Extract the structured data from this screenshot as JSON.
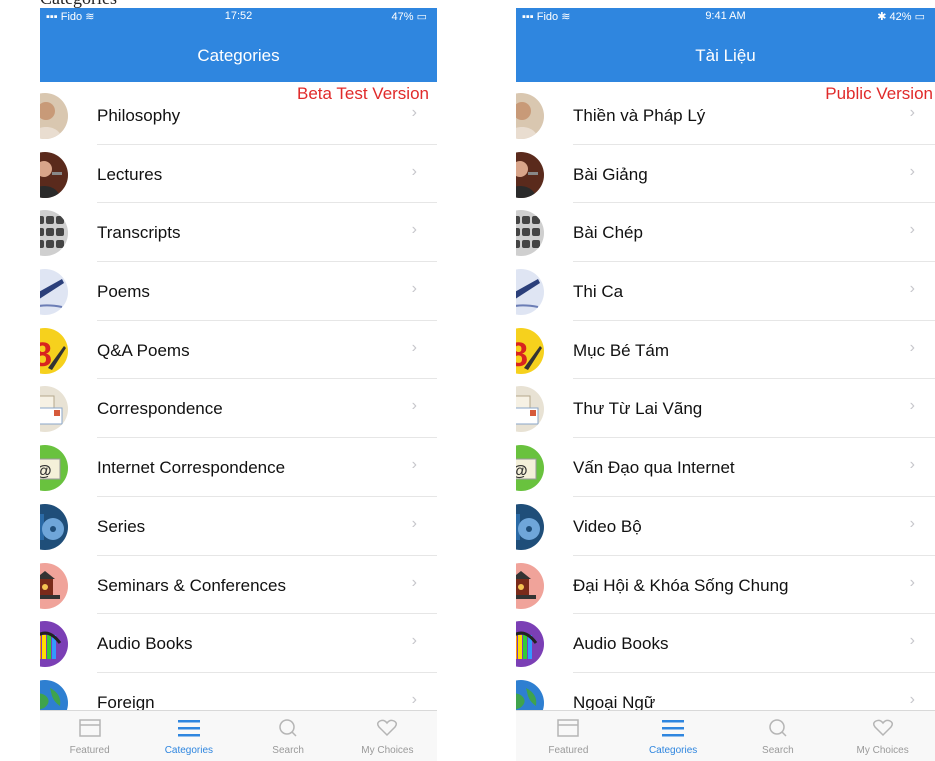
{
  "caption": {
    "text": "Categories"
  },
  "screens": [
    {
      "status": {
        "carrier": "Fido",
        "time": "17:52",
        "battery": "47%"
      },
      "title": "Categories",
      "version_label": "Beta Test Version",
      "items": [
        {
          "label": "Philosophy",
          "icon": "monk-portrait-icon"
        },
        {
          "label": "Lectures",
          "icon": "speaker-portrait-icon"
        },
        {
          "label": "Transcripts",
          "icon": "keyboard-icon"
        },
        {
          "label": "Poems",
          "icon": "fountain-pen-icon"
        },
        {
          "label": "Q&A Poems",
          "icon": "red-8-pen-icon"
        },
        {
          "label": "Correspondence",
          "icon": "letters-icon"
        },
        {
          "label": "Internet Correspondence",
          "icon": "email-at-icon"
        },
        {
          "label": "Series",
          "icon": "dvd-icon"
        },
        {
          "label": "Seminars & Conferences",
          "icon": "temple-icon"
        },
        {
          "label": "Audio Books",
          "icon": "headphones-books-icon"
        },
        {
          "label": "Foreign",
          "icon": "globe-icon"
        }
      ],
      "tabs": [
        {
          "label": "Featured",
          "icon": "featured-icon",
          "active": false
        },
        {
          "label": "Categories",
          "icon": "menu-lines-icon",
          "active": true
        },
        {
          "label": "Search",
          "icon": "search-icon",
          "active": false
        },
        {
          "label": "My Choices",
          "icon": "heart-icon",
          "active": false
        }
      ]
    },
    {
      "status": {
        "carrier": "Fido",
        "time": "9:41 AM",
        "battery": "42%"
      },
      "title": "Tài Liệu",
      "version_label": "Public Version",
      "items": [
        {
          "label": "Thiền và Pháp Lý",
          "icon": "monk-portrait-icon"
        },
        {
          "label": "Bài Giảng",
          "icon": "speaker-portrait-icon"
        },
        {
          "label": "Bài Chép",
          "icon": "keyboard-icon"
        },
        {
          "label": "Thi Ca",
          "icon": "fountain-pen-icon"
        },
        {
          "label": "Mục Bé Tám",
          "icon": "red-8-pen-icon"
        },
        {
          "label": "Thư Từ Lai Vãng",
          "icon": "letters-icon"
        },
        {
          "label": "Vấn Đạo qua Internet",
          "icon": "email-at-icon"
        },
        {
          "label": "Video Bộ",
          "icon": "dvd-icon"
        },
        {
          "label": "Đại Hội & Khóa Sống Chung",
          "icon": "temple-icon"
        },
        {
          "label": "Audio Books",
          "icon": "headphones-books-icon"
        },
        {
          "label": "Ngoại Ngữ",
          "icon": "globe-icon"
        }
      ],
      "tabs": [
        {
          "label": "Featured",
          "icon": "featured-icon",
          "active": false
        },
        {
          "label": "Categories",
          "icon": "menu-lines-icon",
          "active": true
        },
        {
          "label": "Search",
          "icon": "search-icon",
          "active": false
        },
        {
          "label": "My Choices",
          "icon": "heart-icon",
          "active": false
        }
      ]
    }
  ],
  "colors": {
    "header": "#2f86df",
    "version_label": "#e02a2a",
    "active_tab": "#2f86df",
    "inactive_tab": "#9a9a9a",
    "chevron": "#c7c7cc"
  }
}
